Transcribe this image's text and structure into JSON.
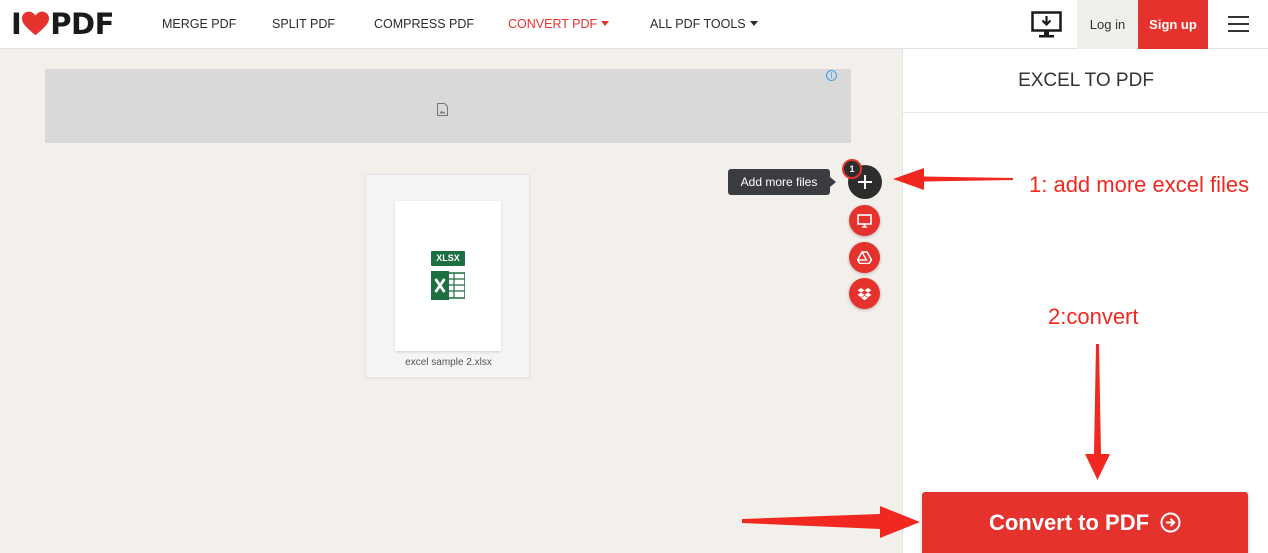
{
  "header": {
    "logo": {
      "left": "I",
      "right": "PDF"
    },
    "nav": [
      {
        "label": "MERGE PDF"
      },
      {
        "label": "SPLIT PDF"
      },
      {
        "label": "COMPRESS PDF"
      },
      {
        "label": "CONVERT PDF"
      },
      {
        "label": "ALL PDF TOOLS"
      }
    ],
    "login_label": "Log in",
    "signup_label": "Sign up"
  },
  "file": {
    "badge": "XLSX",
    "name": "excel sample 2.xlsx"
  },
  "upload": {
    "tooltip": "Add more files",
    "count": "1"
  },
  "panel": {
    "title": "EXCEL TO PDF",
    "convert_label": "Convert to PDF"
  },
  "annotations": {
    "step1": "1: add more excel files",
    "step2": "2:convert"
  },
  "colors": {
    "brand_red": "#e5322d",
    "annotation_red": "#f0281f",
    "excel_green": "#1d6f42"
  }
}
